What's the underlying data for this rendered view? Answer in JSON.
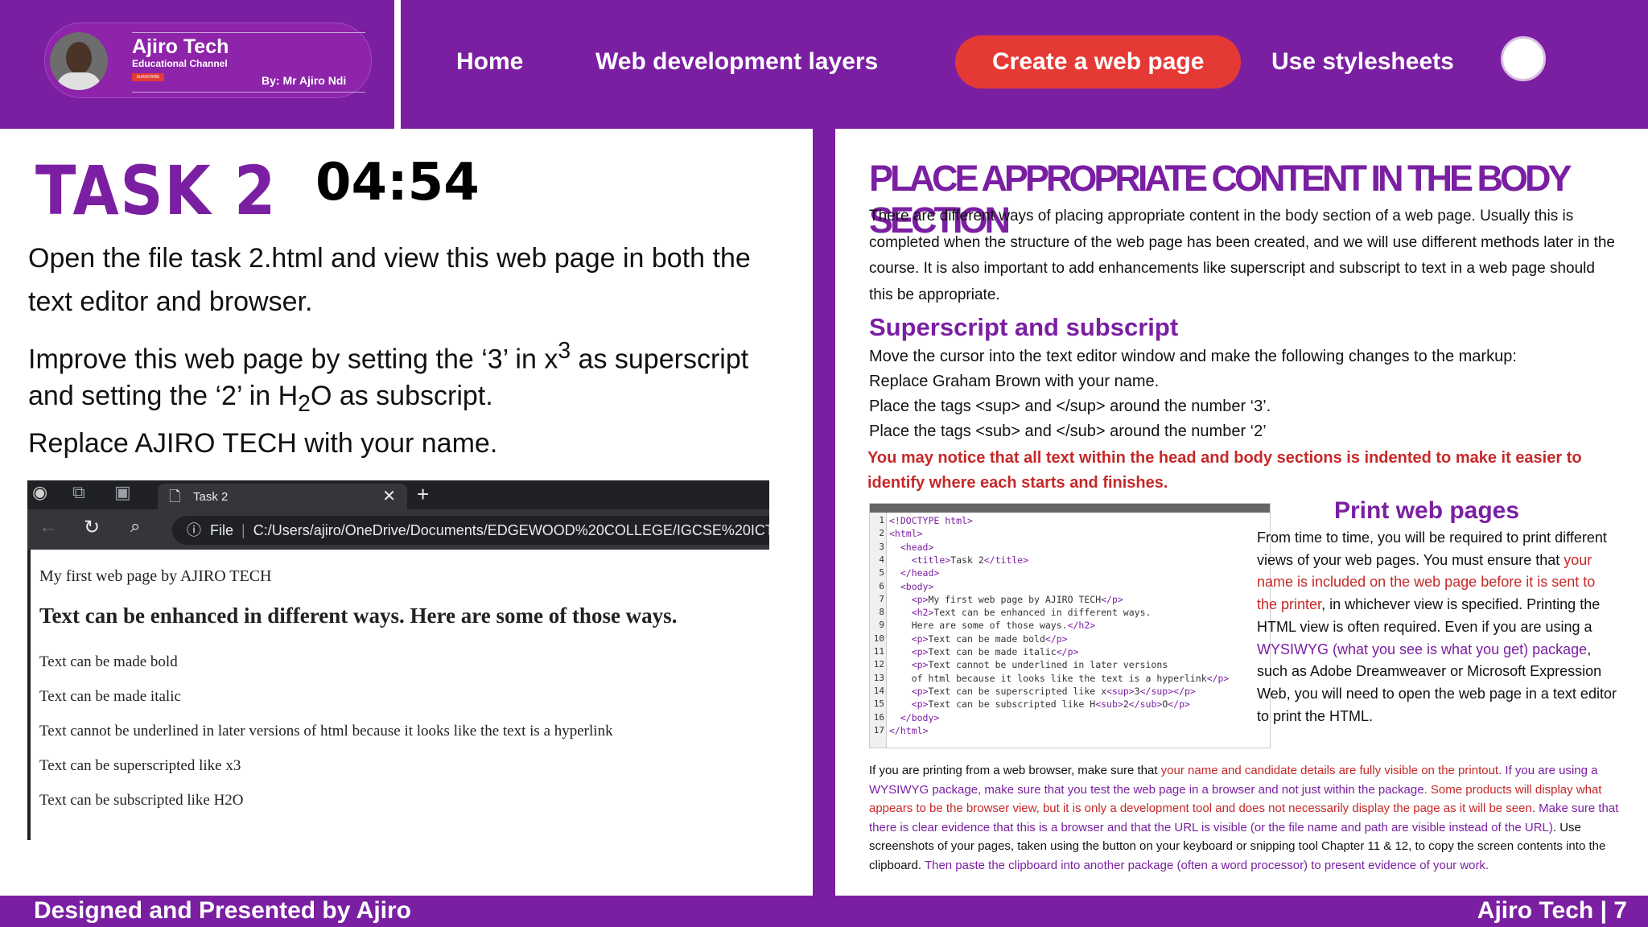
{
  "brand": {
    "name": "Ajiro Tech",
    "subtitle": "Educational Channel",
    "subscribe": "SUBSCRIBE",
    "by": "By: Mr Ajiro Ndi"
  },
  "nav": {
    "home": "Home",
    "layers": "Web development layers",
    "create": "Create a web page",
    "stylesheets": "Use stylesheets"
  },
  "left": {
    "task_title": "TASK 2",
    "timer": "04:54",
    "p1": "Open the file task 2.html and view this web page in both the text editor and browser.",
    "p2_a": "Improve this web page by setting the ‘3’ in x",
    "p2_sup": "3",
    "p2_b": " as superscript and setting the ‘2’ in H",
    "p2_sub": "2",
    "p2_c": "O as subscript.",
    "p3": "Replace AJIRO TECH with your name."
  },
  "browser": {
    "tab_title": "Task 2",
    "url_label": "File",
    "url": "C:/Users/ajiro/OneDrive/Documents/EDGEWOOD%20COLLEGE/IGCSE%20ICT%20",
    "lines": [
      "My first web page by AJIRO TECH",
      "Text can be enhanced in different ways. Here are some of those ways.",
      "Text can be made bold",
      "Text can be made italic",
      "Text cannot be underlined in later versions of html because it looks like the text is a hyperlink",
      "Text can be superscripted like x3",
      "Text can be subscripted like H2O"
    ]
  },
  "right": {
    "heading": "PLACE APPROPRIATE CONTENT IN THE BODY SECTION",
    "intro": "There are different ways of placing appropriate content in the body section of a web page. Usually this is completed when the structure of the web page has been created, and we will use different methods later in the course. It is also important to add enhancements like superscript and subscript to text in a web page should this be appropriate.",
    "sub_heading": "Superscript and subscript",
    "instruction": "Move the cursor into the text editor window and make the following changes to the markup:",
    "bullets": [
      "Replace Graham Brown with your name.",
      "Place the tags <sup> and </sup> around the number ‘3’.",
      "Place the tags <sub> and </sub> around the number ‘2’"
    ],
    "red_note": "You may notice that all text within the head and body sections is indented to make it easier to identify where each starts and finishes.",
    "print_heading": "Print web pages",
    "print_a": "From time to time, you will be required to print different views of your web pages. You must ensure that ",
    "print_red": "your name is included on the web page before it is sent to the printer",
    "print_b": ", in whichever view is specified. Printing the HTML view is often required. Even if you are using a ",
    "print_purple": "WYSIWYG (what you see is what you get) package",
    "print_c": ", such as Adobe Dreamweaver or Microsoft Expression Web, you will need to open the web page in a text editor to print the HTML.",
    "note_a": "If you are printing from a web browser, make sure that ",
    "note_red1": "your name and candidate details are fully visible on the printout",
    "note_purple1": ". If you are using a WYSIWYG package, make sure that you test the web page in a browser and not just within the package",
    "note_red2": ". Some products will display what appears to be the browser view, but it is only a development tool and does not necessarily display the page as it will be seen",
    "note_purple2": ". Make sure that there is clear evidence that this is a browser and that the URL is visible (or the file name and path are visible instead of the URL)",
    "note_b": ". Use screenshots of your pages, taken using the button on your keyboard or snipping tool Chapter 11 & 12, to copy the screen contents into the clipboard. ",
    "note_purple3": "Then paste the clipboard into another package (often a word processor) to present evidence of your work."
  },
  "code": [
    "<!DOCTYPE html>",
    "<html>",
    "  <head>",
    "    <title>Task 2</title>",
    "  </head>",
    "  <body>",
    "    <p>My first web page by AJIRO TECH</p>",
    "    <h2>Text can be enhanced in different ways.",
    "    Here are some of those ways.</h2>",
    "    <p>Text can be made bold</p>",
    "    <p>Text can be made italic</p>",
    "    <p>Text cannot be underlined in later versions",
    "    of html because it looks like the text is a hyperlink</p>",
    "    <p>Text can be superscripted like x<sup>3</sup></p>",
    "    <p>Text can be subscripted like H<sub>2</sub>O</p>",
    "  </body>",
    "</html>"
  ],
  "footer": {
    "left": "Designed and Presented by Ajiro",
    "right": "Ajiro Tech | 7"
  }
}
